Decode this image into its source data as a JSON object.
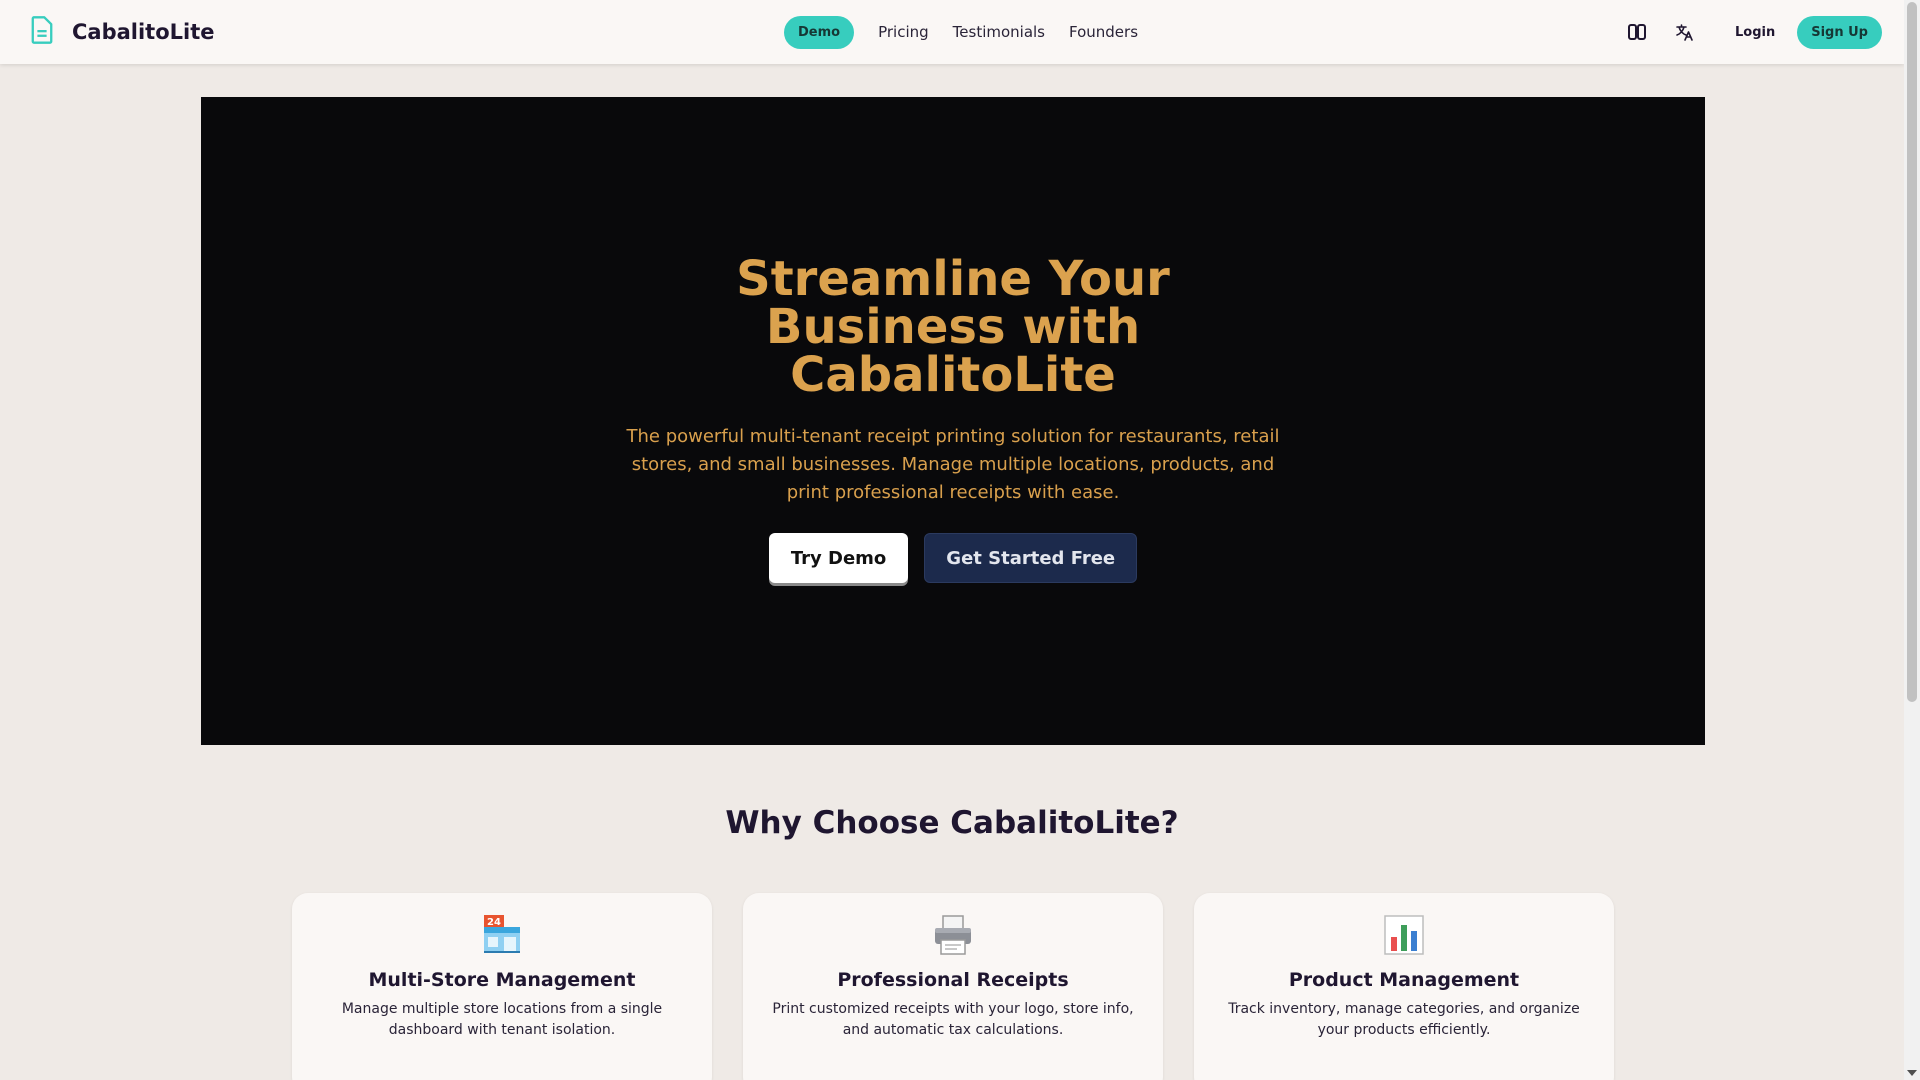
{
  "brand": {
    "name": "CabalitoLite",
    "icon": "document-icon"
  },
  "nav": {
    "demo_label": "Demo",
    "links": [
      "Pricing",
      "Testimonials",
      "Founders"
    ],
    "theme_icon": "theme-toggle-icon",
    "language_icon": "translate-icon",
    "login_label": "Login",
    "signup_label": "Sign Up"
  },
  "hero": {
    "title": "Streamline Your Business with CabalitoLite",
    "subtitle": "The powerful multi-tenant receipt printing solution for restaurants, retail stores, and small businesses. Manage multiple locations, products, and print professional receipts with ease.",
    "try_demo_label": "Try Demo",
    "get_started_label": "Get Started Free"
  },
  "features": {
    "title": "Why Choose CabalitoLite?",
    "cards": [
      {
        "icon": "store-icon",
        "title": "Multi-Store Management",
        "description": "Manage multiple store locations from a single dashboard with tenant isolation."
      },
      {
        "icon": "printer-icon",
        "title": "Professional Receipts",
        "description": "Print customized receipts with your logo, store info, and automatic tax calculations."
      },
      {
        "icon": "bar-chart-icon",
        "title": "Product Management",
        "description": "Track inventory, manage categories, and organize your products efficiently."
      }
    ]
  },
  "colors": {
    "accent": "#37cdbe",
    "hero_text": "#dba24e",
    "hero_bg": "#09090b",
    "page_bg": "#efeae6"
  }
}
